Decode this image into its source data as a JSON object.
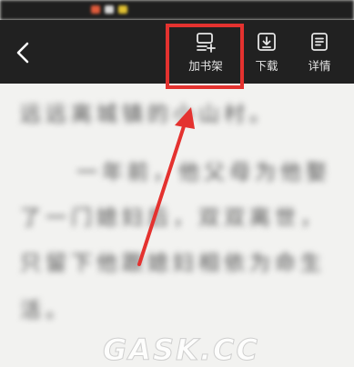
{
  "toolbar": {
    "actions": [
      {
        "label": "加书架",
        "icon": "add-to-bookshelf-icon"
      },
      {
        "label": "下载",
        "icon": "download-icon"
      },
      {
        "label": "详情",
        "icon": "details-icon"
      }
    ]
  },
  "reader": {
    "lines": [
      "远远离城镇的小山村。",
      "一年前，他父母为他娶",
      "了一门媳妇后，双双离世，",
      "只留下他跟媳妇相依为命生",
      "活。"
    ]
  },
  "annotation": {
    "box_color": "#e4322f",
    "arrow_color": "#e4322f"
  },
  "watermark": {
    "text": "GASK.CC"
  }
}
